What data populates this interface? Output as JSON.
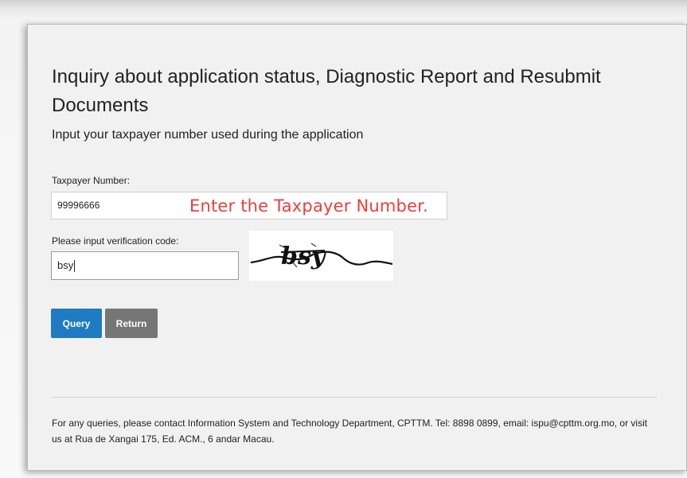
{
  "page": {
    "title": "Inquiry about application status, Diagnostic Report and Resubmit Documents",
    "subtitle": "Input your taxpayer number used during the application"
  },
  "form": {
    "taxpayer_label": "Taxpayer Number:",
    "taxpayer_value": "99996666",
    "taxpayer_annotation": "Enter the Taxpayer Number.",
    "code_label": "Please input verification code:",
    "code_value": "bsy",
    "captcha_text": "bsy"
  },
  "buttons": {
    "query_label": "Query",
    "return_label": "Return"
  },
  "footer": {
    "text": "For any queries, please contact Information System and Technology Department, CPTTM. Tel: 8898 0899, email: ispu@cpttm.org.mo, or visit us at Rua de Xangai 175, Ed. ACM., 6 andar Macau."
  },
  "colors": {
    "query_button": "#1f7bc1",
    "return_button": "#767676",
    "annotation": "#e8413c",
    "panel_background": "#f1f1f1"
  }
}
